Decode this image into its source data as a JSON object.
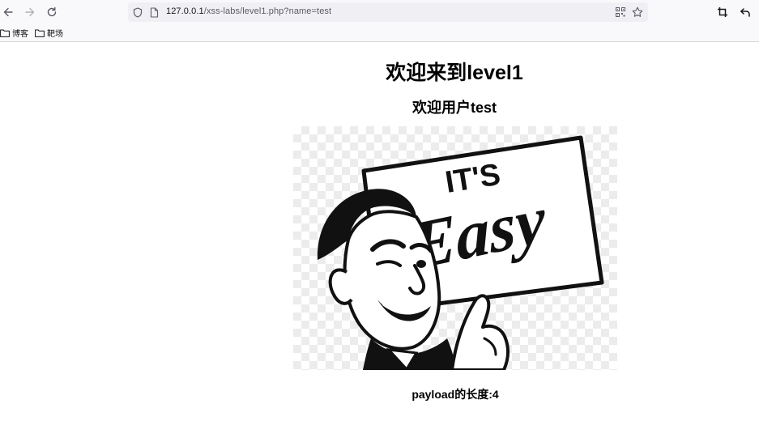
{
  "browser": {
    "url_host": "127.0.0.1",
    "url_path": "/xss-labs/level1.php?name=test",
    "bookmarks": [
      "博客",
      "靶场"
    ]
  },
  "page": {
    "title": "欢迎来到level1",
    "welcome": "欢迎用户test",
    "image_text": {
      "line1": "IT'S",
      "line2": "Easy"
    },
    "payload_length": "payload的长度:4"
  },
  "colors": {
    "chrome_bg": "#f9f9fb",
    "urlbar_bg": "#f0f0f4",
    "text": "#000000"
  }
}
